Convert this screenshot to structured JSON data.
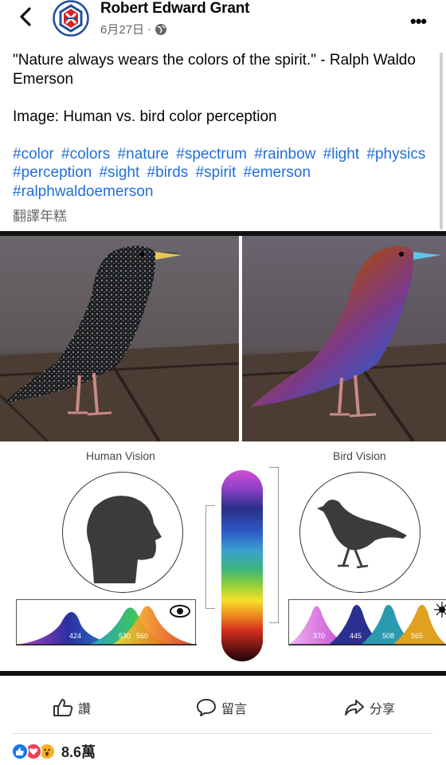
{
  "header": {
    "author": "Robert Edward Grant",
    "date": "6月27日",
    "separator": "·",
    "back_icon": "chevron-left-icon",
    "more_icon": "more-icon",
    "privacy_icon": "globe-icon"
  },
  "post": {
    "quote": "\"Nature always wears the colors of the spirit.\" - Ralph Waldo Emerson",
    "caption": "Image: Human vs. bird color perception",
    "hashtags": [
      "#color",
      "#colors",
      "#nature",
      "#spectrum",
      "#rainbow",
      "#light",
      "#physics",
      "#perception",
      "#sight",
      "#birds",
      "#spirit",
      "#emerson",
      "#ralphwaldoemerson"
    ],
    "translate": "翻譯年糕"
  },
  "image": {
    "human_label": "Human Vision",
    "bird_label": "Bird Vision",
    "human_peaks": [
      "424",
      "530",
      "560"
    ],
    "bird_peaks": [
      "370",
      "445",
      "508",
      "565"
    ]
  },
  "actions": {
    "like": "讚",
    "comment": "留言",
    "share": "分享"
  },
  "reactions": {
    "count": "8.6萬",
    "types": [
      "like",
      "love",
      "wow"
    ]
  },
  "colors": {
    "link": "#216fdb",
    "like_blue": "#1877f2",
    "love_red": "#f33e58",
    "wow_yellow": "#f7b125"
  }
}
